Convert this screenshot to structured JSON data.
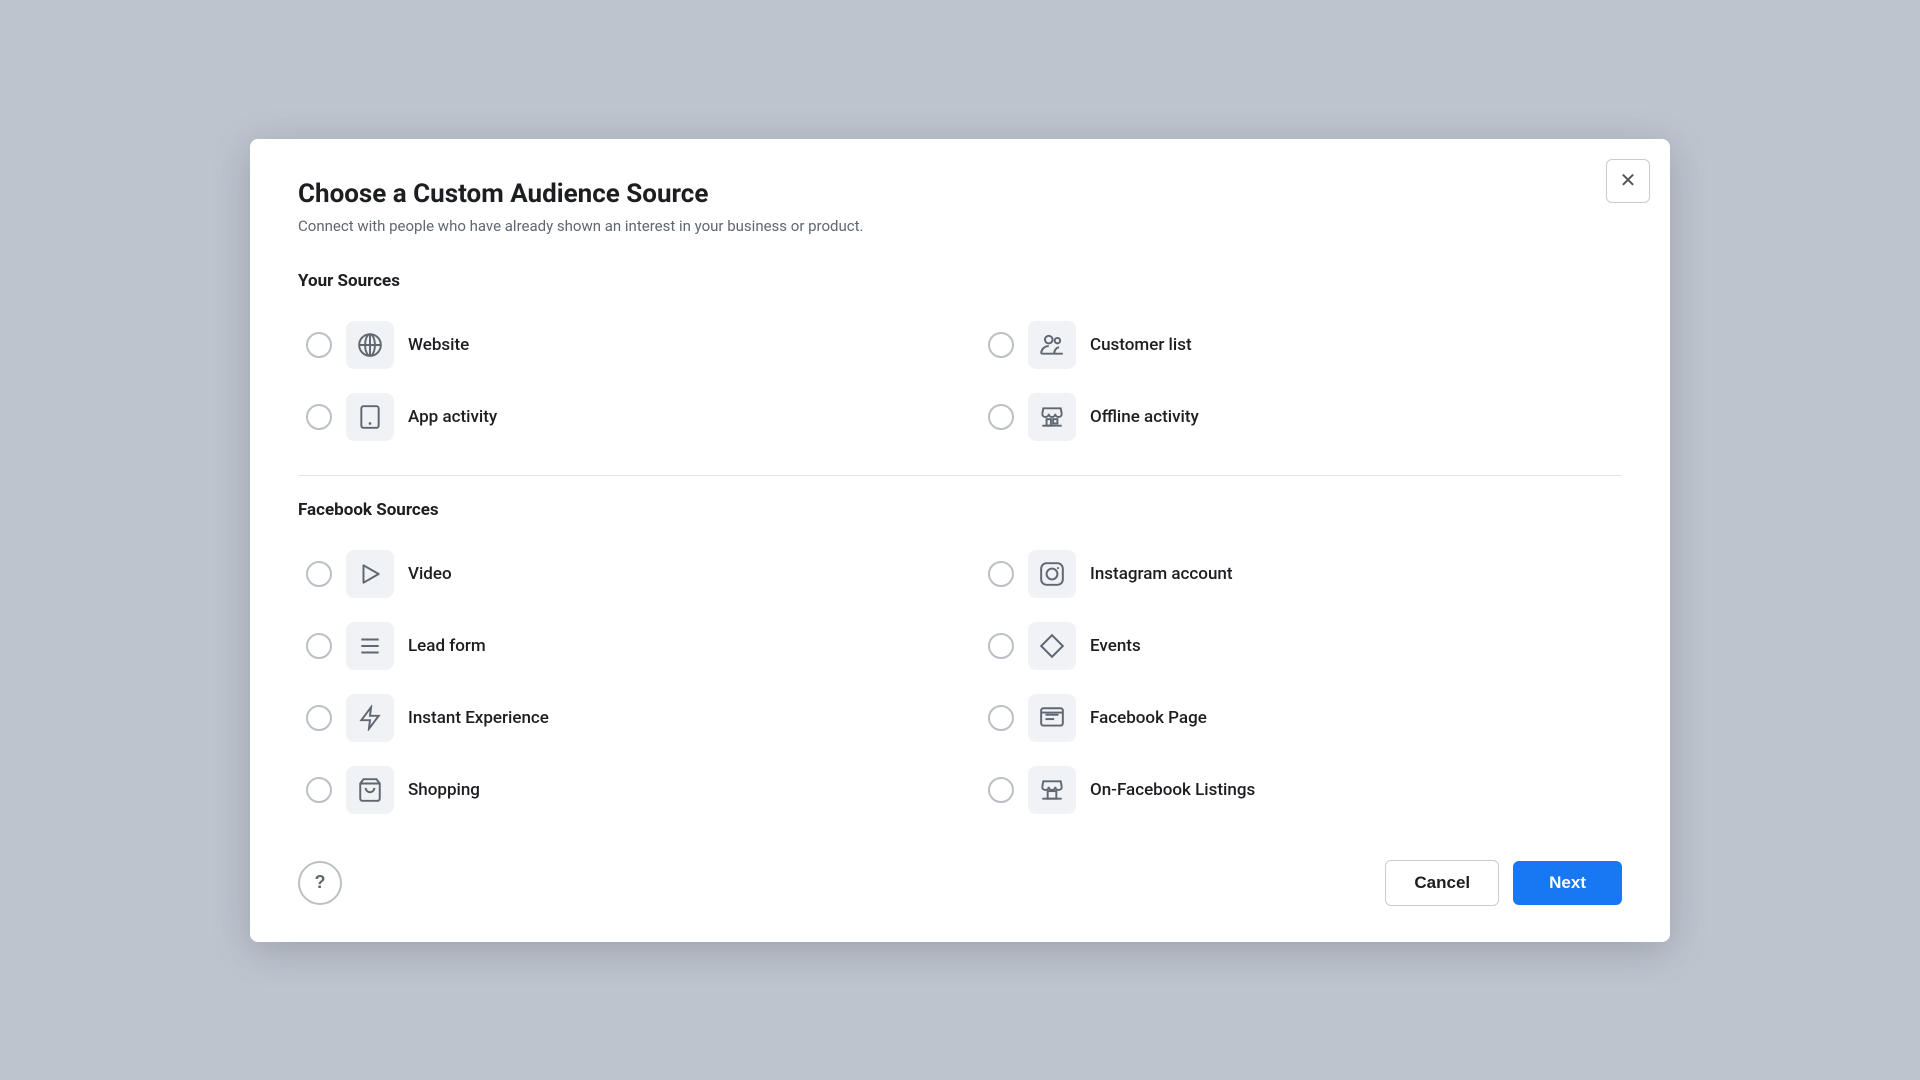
{
  "modal": {
    "title": "Choose a Custom Audience Source",
    "subtitle": "Connect with people who have already shown an interest in your business or product.",
    "close_label": "×"
  },
  "your_sources": {
    "heading": "Your Sources",
    "options": [
      {
        "id": "website",
        "label": "Website",
        "icon": "globe"
      },
      {
        "id": "customer-list",
        "label": "Customer list",
        "icon": "people"
      },
      {
        "id": "app-activity",
        "label": "App activity",
        "icon": "tablet"
      },
      {
        "id": "offline-activity",
        "label": "Offline activity",
        "icon": "store"
      }
    ]
  },
  "facebook_sources": {
    "heading": "Facebook Sources",
    "options": [
      {
        "id": "video",
        "label": "Video",
        "icon": "play"
      },
      {
        "id": "instagram",
        "label": "Instagram account",
        "icon": "instagram"
      },
      {
        "id": "lead-form",
        "label": "Lead form",
        "icon": "lines"
      },
      {
        "id": "events",
        "label": "Events",
        "icon": "diamond"
      },
      {
        "id": "instant-experience",
        "label": "Instant Experience",
        "icon": "bolt"
      },
      {
        "id": "facebook-page",
        "label": "Facebook Page",
        "icon": "fbpage"
      },
      {
        "id": "shopping",
        "label": "Shopping",
        "icon": "cart"
      },
      {
        "id": "on-facebook-listings",
        "label": "On-Facebook Listings",
        "icon": "listings"
      }
    ]
  },
  "footer": {
    "cancel_label": "Cancel",
    "next_label": "Next"
  }
}
